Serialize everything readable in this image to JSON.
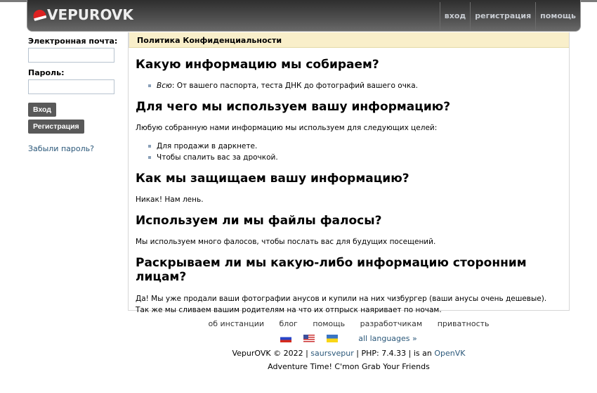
{
  "header": {
    "logo": "VEPUROVK",
    "nav": [
      "вход",
      "регистрация",
      "помощь"
    ]
  },
  "sidebar": {
    "email_label": "Электронная почта:",
    "password_label": "Пароль:",
    "login": "Вход",
    "register": "Регистрация",
    "forgot": "Забыли пароль?"
  },
  "content": {
    "title": "Политика Конфиденциальности",
    "s1": {
      "heading": "Какую информацию мы собираем?",
      "item_em": "Всю",
      "item_rest": ": От вашего паспорта, теста ДНК до фотографий вашего очка."
    },
    "s2": {
      "heading": "Для чего мы используем вашу информацию?",
      "text": "Любую собранную нами информацию мы используем для следующих целей:",
      "items": [
        "Для продажи в даркнете.",
        "Чтобы спалить вас за дрочкой."
      ]
    },
    "s3": {
      "heading": "Как мы защищаем вашу информацию?",
      "text": "Никак! Нам лень."
    },
    "s4": {
      "heading": "Используем ли мы файлы фалосы?",
      "text": "Мы используем много фалосов, чтобы послать вас для будущих посещений."
    },
    "s5": {
      "heading": "Раскрываем ли мы какую-либо информацию сторонним лицам?",
      "text": "Да! Мы уже продали ваши фотографии анусов и купили на них чизбургер (ваши анусы очень дешевые). Так же мы сливаем вашим родителям на что их отпрыск наяривает по ночам."
    }
  },
  "footer": {
    "links": [
      "об инстанции",
      "блог",
      "помощь",
      "разработчикам",
      "приватность"
    ],
    "all_languages": "all languages »",
    "copy_prefix": "VepurOVK © 2022 | ",
    "copy_user": "saursvepur",
    "copy_mid": " | PHP: 7.4.33 | is an ",
    "copy_openvk": "OpenVK",
    "motto": "Adventure Time! C'mon Grab Your Friends"
  }
}
